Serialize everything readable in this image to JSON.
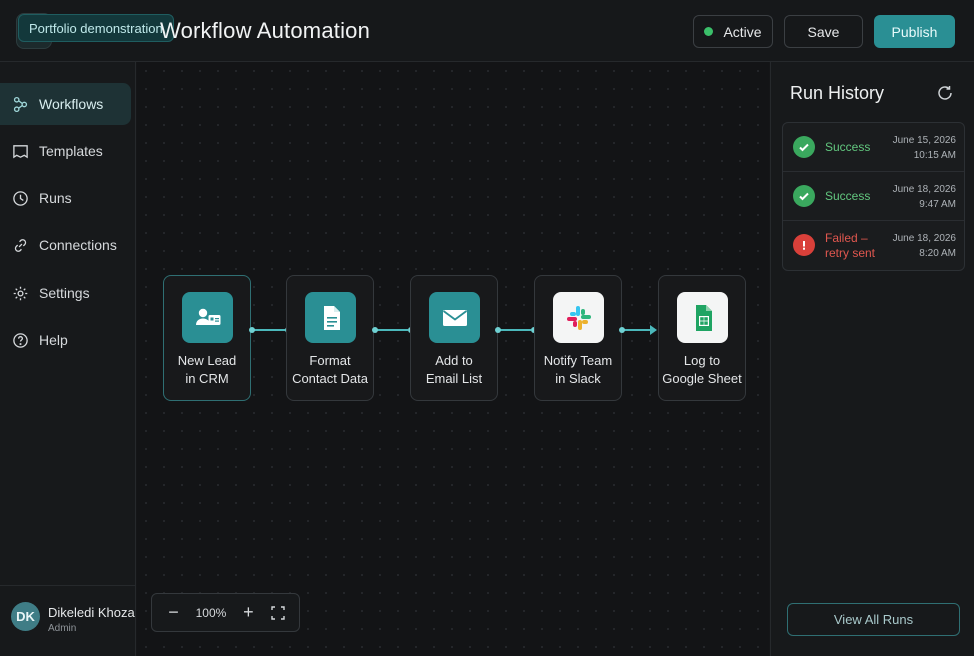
{
  "header": {
    "demo_badge": "Portfolio demonstration",
    "title": "Workflow Automation",
    "status_label": "Active",
    "save_label": "Save",
    "publish_label": "Publish",
    "colors": {
      "accent": "#2a8f94",
      "active_dot": "#3bbf6a"
    }
  },
  "sidebar": {
    "items": [
      {
        "label": "Workflows",
        "icon": "workflow-icon",
        "active": true
      },
      {
        "label": "Templates",
        "icon": "template-icon",
        "active": false
      },
      {
        "label": "Runs",
        "icon": "clock-icon",
        "active": false
      },
      {
        "label": "Connections",
        "icon": "link-icon",
        "active": false
      },
      {
        "label": "Settings",
        "icon": "gear-icon",
        "active": false
      },
      {
        "label": "Help",
        "icon": "help-icon",
        "active": false
      }
    ],
    "user": {
      "initials": "DK",
      "name": "Dikeledi Khoza",
      "role": "Admin"
    }
  },
  "canvas": {
    "nodes": [
      {
        "line1": "New Lead",
        "line2": "in CRM",
        "icon": "contact-card-icon"
      },
      {
        "line1": "Format",
        "line2": "Contact Data",
        "icon": "document-icon"
      },
      {
        "line1": "Add to",
        "line2": "Email List",
        "icon": "mail-icon"
      },
      {
        "line1": "Notify Team",
        "line2": "in Slack",
        "icon": "slack-icon"
      },
      {
        "line1": "Log to",
        "line2": "Google Sheet",
        "icon": "google-sheets-icon"
      }
    ],
    "zoom": {
      "out": "−",
      "level": "100%",
      "in": "+",
      "fit_icon": "fit-screen-icon"
    }
  },
  "run_history": {
    "title": "Run History",
    "runs": [
      {
        "status": "Success",
        "date": "June 15, 2026",
        "time": "10:15 AM",
        "state": "success"
      },
      {
        "status": "Success",
        "date": "June 18, 2026",
        "time": "9:47 AM",
        "state": "success"
      },
      {
        "status": "Failed – retry sent",
        "date": "June 18, 2026",
        "time": "8:20 AM",
        "state": "failed"
      }
    ],
    "view_all_label": "View All Runs",
    "colors": {
      "success": "#3aa85e",
      "failed": "#d9403a"
    }
  }
}
